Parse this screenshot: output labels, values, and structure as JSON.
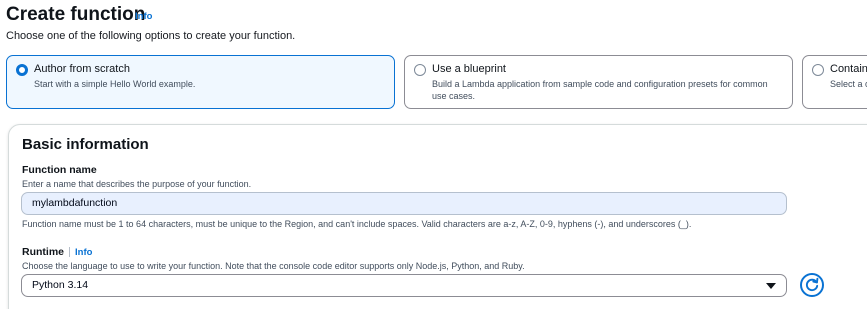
{
  "header": {
    "title": "Create function",
    "info_label": "Info",
    "description": "Choose one of the following options to create your function."
  },
  "options": [
    {
      "title": "Author from scratch",
      "description": "Start with a simple Hello World example.",
      "selected": true
    },
    {
      "title": "Use a blueprint",
      "description": "Build a Lambda application from sample code and configuration presets for common use cases.",
      "selected": false
    },
    {
      "title": "Containe",
      "description": "Select a c",
      "selected": false
    }
  ],
  "basic_info": {
    "title": "Basic information",
    "function_name": {
      "label": "Function name",
      "description": "Enter a name that describes the purpose of your function.",
      "value": "mylambdafunction",
      "constraint": "Function name must be 1 to 64 characters, must be unique to the Region, and can't include spaces. Valid characters are a-z, A-Z, 0-9, hyphens (-), and underscores (_)."
    },
    "runtime": {
      "label": "Runtime",
      "info_label": "Info",
      "description": "Choose the language to use to write your function. Note that the console code editor supports only Node.js, Python, and Ruby.",
      "selected": "Python 3.14"
    }
  },
  "icons": {
    "refresh": "refresh-icon",
    "caret": "caret-down-icon"
  },
  "colors": {
    "accent": "#0972d3",
    "selected_bg": "#f0f8ff",
    "input_autofill_bg": "#e8f0fe"
  }
}
